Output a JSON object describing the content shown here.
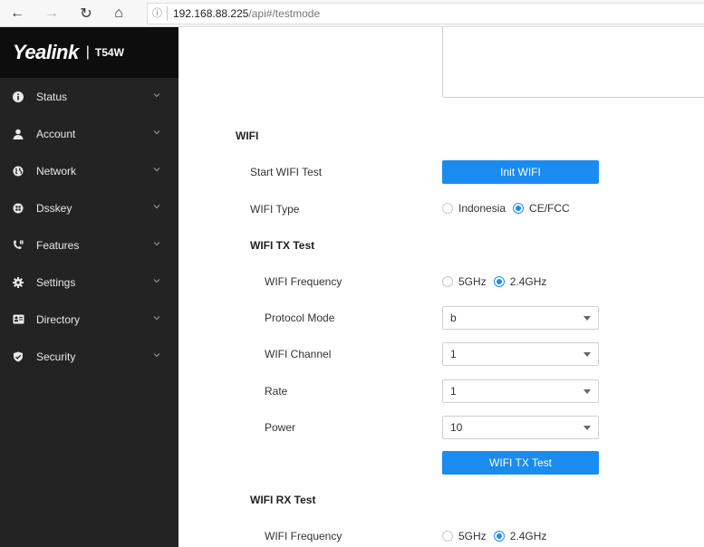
{
  "browser": {
    "url_host": "192.168.88.225",
    "url_path": "/api#/testmode",
    "back_glyph": "←",
    "forward_glyph": "→",
    "refresh_glyph": "↻",
    "home_glyph": "⌂",
    "info_glyph": "ⓘ"
  },
  "brand": {
    "logo": "Yealink",
    "separator": "|",
    "model": "T54W"
  },
  "sidebar": {
    "items": [
      {
        "label": "Status",
        "icon": "info-circle-icon"
      },
      {
        "label": "Account",
        "icon": "user-icon"
      },
      {
        "label": "Network",
        "icon": "globe-icon"
      },
      {
        "label": "Dsskey",
        "icon": "grid-circle-icon"
      },
      {
        "label": "Features",
        "icon": "phone-icon"
      },
      {
        "label": "Settings",
        "icon": "gear-icon"
      },
      {
        "label": "Directory",
        "icon": "contact-card-icon"
      },
      {
        "label": "Security",
        "icon": "shield-icon"
      }
    ]
  },
  "colors": {
    "accent": "#1a8cf0",
    "sidebar_bg": "#232323",
    "brand_bg": "#0d0d0d"
  },
  "wifi": {
    "section_title": "WIFI",
    "start_test_label": "Start WIFI Test",
    "init_button": "Init WIFI",
    "type_label": "WIFI Type",
    "type_options": [
      "Indonesia",
      "CE/FCC"
    ],
    "type_selected": "CE/FCC",
    "tx": {
      "title": "WIFI TX Test",
      "frequency_label": "WIFI Frequency",
      "frequency_options": [
        "5GHz",
        "2.4GHz"
      ],
      "frequency_selected": "2.4GHz",
      "protocol_label": "Protocol Mode",
      "protocol_value": "b",
      "channel_label": "WIFI Channel",
      "channel_value": "1",
      "rate_label": "Rate",
      "rate_value": "1",
      "power_label": "Power",
      "power_value": "10",
      "test_button": "WIFI TX Test"
    },
    "rx": {
      "title": "WIFI RX Test",
      "frequency_label": "WIFI Frequency",
      "frequency_options": [
        "5GHz",
        "2.4GHz"
      ],
      "frequency_selected": "2.4GHz"
    }
  }
}
